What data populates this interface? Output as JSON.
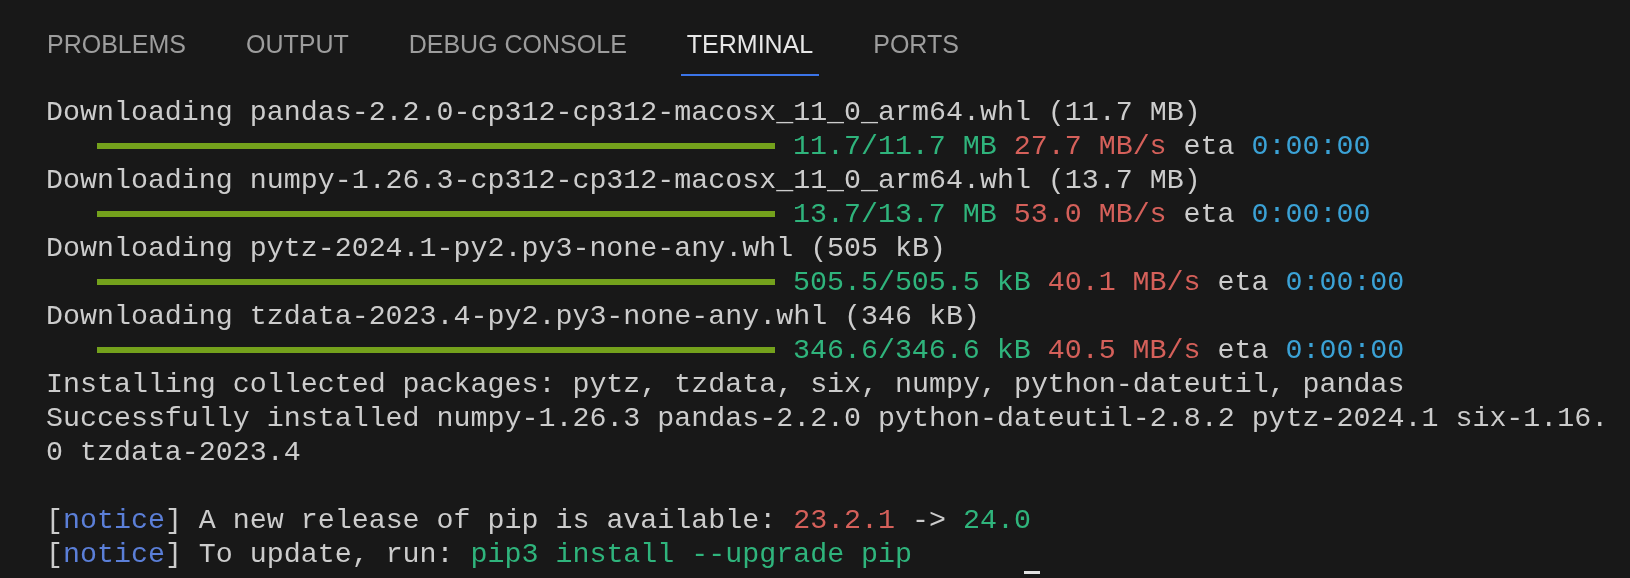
{
  "tabs": [
    {
      "label": "PROBLEMS",
      "selected": false
    },
    {
      "label": "OUTPUT",
      "selected": false
    },
    {
      "label": "DEBUG CONSOLE",
      "selected": false
    },
    {
      "label": "TERMINAL",
      "selected": true
    },
    {
      "label": "PORTS",
      "selected": false
    }
  ],
  "terminal": {
    "lines": [
      {
        "kind": "text",
        "segments": [
          {
            "text": "Downloading pandas-2.2.0-cp312-cp312-macosx_11_0_arm64.whl (11.7 MB)"
          }
        ]
      },
      {
        "kind": "progress",
        "level": 1,
        "segments": [
          {
            "text": "11.7/11.7 MB ",
            "color": "#2fb47c"
          },
          {
            "text": "27.7 MB/s",
            "color": "#d5605a"
          },
          {
            "text": " eta "
          },
          {
            "text": "0:00:00",
            "color": "#3ba2d6"
          }
        ]
      },
      {
        "kind": "text",
        "segments": [
          {
            "text": "Downloading numpy-1.26.3-cp312-cp312-macosx_11_0_arm64.whl (13.7 MB)"
          }
        ]
      },
      {
        "kind": "progress",
        "level": 1,
        "segments": [
          {
            "text": "13.7/13.7 MB ",
            "color": "#2fb47c"
          },
          {
            "text": "53.0 MB/s",
            "color": "#d5605a"
          },
          {
            "text": " eta "
          },
          {
            "text": "0:00:00",
            "color": "#3ba2d6"
          }
        ]
      },
      {
        "kind": "text",
        "segments": [
          {
            "text": "Downloading pytz-2024.1-py2.py3-none-any.whl (505 kB)"
          }
        ]
      },
      {
        "kind": "progress",
        "level": 1,
        "segments": [
          {
            "text": "505.5/505.5 kB ",
            "color": "#2fb47c"
          },
          {
            "text": "40.1 MB/s",
            "color": "#d5605a"
          },
          {
            "text": " eta "
          },
          {
            "text": "0:00:00",
            "color": "#3ba2d6"
          }
        ]
      },
      {
        "kind": "text",
        "segments": [
          {
            "text": "Downloading tzdata-2023.4-py2.py3-none-any.whl (346 kB)"
          }
        ]
      },
      {
        "kind": "progress",
        "level": 1,
        "segments": [
          {
            "text": "346.6/346.6 kB ",
            "color": "#2fb47c"
          },
          {
            "text": "40.5 MB/s",
            "color": "#d5605a"
          },
          {
            "text": " eta "
          },
          {
            "text": "0:00:00",
            "color": "#3ba2d6"
          }
        ]
      },
      {
        "kind": "text",
        "segments": [
          {
            "text": "Installing collected packages: pytz, tzdata, six, numpy, python-dateutil, pandas"
          }
        ]
      },
      {
        "kind": "text",
        "segments": [
          {
            "text": "Successfully installed numpy-1.26.3 pandas-2.2.0 python-dateutil-2.8.2 pytz-2024.1 six-1.16."
          }
        ]
      },
      {
        "kind": "text",
        "segments": [
          {
            "text": "0 tzdata-2023.4"
          }
        ]
      },
      {
        "kind": "blank"
      },
      {
        "kind": "text",
        "segments": [
          {
            "text": "["
          },
          {
            "text": "notice",
            "color": "#5b7fd8"
          },
          {
            "text": "] A new release of pip is available: "
          },
          {
            "text": "23.2.1",
            "color": "#d5605a"
          },
          {
            "text": " -> "
          },
          {
            "text": "24.0",
            "color": "#2fb47c"
          }
        ]
      },
      {
        "kind": "text",
        "segments": [
          {
            "text": "["
          },
          {
            "text": "notice",
            "color": "#5b7fd8"
          },
          {
            "text": "] To update, run: "
          },
          {
            "text": "pip3 install --upgrade pip",
            "color": "#2fb47c"
          }
        ]
      }
    ]
  }
}
